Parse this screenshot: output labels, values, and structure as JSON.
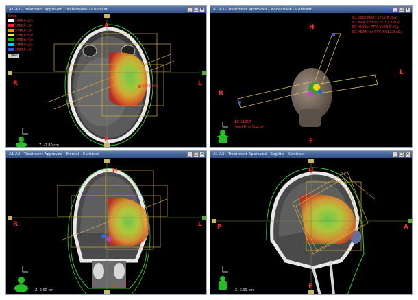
{
  "panels": {
    "transversal": {
      "title": "A1-A3 - Treatment Approved - Transversal - Contrast",
      "orient": {
        "top": "A",
        "bottom": "P",
        "left": "R",
        "right": "L"
      },
      "coord": "Z: -2.80 cm",
      "legend": {
        "title": "Dose",
        "rows": [
          {
            "label": "6396.0 cGy",
            "color": "#ffffff"
          },
          {
            "label": "5952.0 cGy",
            "color": "#ff2020"
          },
          {
            "label": "5746.8 cGy",
            "color": "#ff8c00"
          },
          {
            "label": "5586.0 cGy",
            "color": "#ffff00"
          },
          {
            "label": "4998.0 cGy",
            "color": "#00c000"
          },
          {
            "label": "3498.0 cGy",
            "color": "#00d0ff"
          },
          {
            "label": "2886.0 cGy",
            "color": "#3050ff"
          }
        ],
        "badge": "DIGIT"
      },
      "point_label": "5952 cGy"
    },
    "model": {
      "title": "A1-A3 - Treatment Approved - Model View - Contrast",
      "orient": {
        "top": "H",
        "bottom": "F",
        "left": "R",
        "right": "L"
      },
      "stats": [
        "3D Dose MAX: 5752.8 cGy",
        "3D MAX for PTV: 5752.8 cGy",
        "3D MIN for PTV: 5543.6 cGy",
        "3D MEAN for PTV: 5612.8 cGy"
      ],
      "patient": [
        "IEC 61217",
        "Head First Supine"
      ]
    },
    "frontal": {
      "title": "A1-A3 - Treatment Approved - Frontal - Contrast",
      "orient": {
        "top": "H",
        "bottom": "F",
        "left": "R",
        "right": "L"
      },
      "coord": "Z: 2.90 cm"
    },
    "sagittal": {
      "title": "A1-A3 - Treatment Approved - Sagittal - Contrast",
      "orient": {
        "top": "H",
        "bottom": "F",
        "left": "P",
        "right": "A"
      },
      "coord": "X: 3.99 cm"
    }
  },
  "window_buttons": {
    "minimize": "_",
    "maximize": "□",
    "close": "×"
  }
}
